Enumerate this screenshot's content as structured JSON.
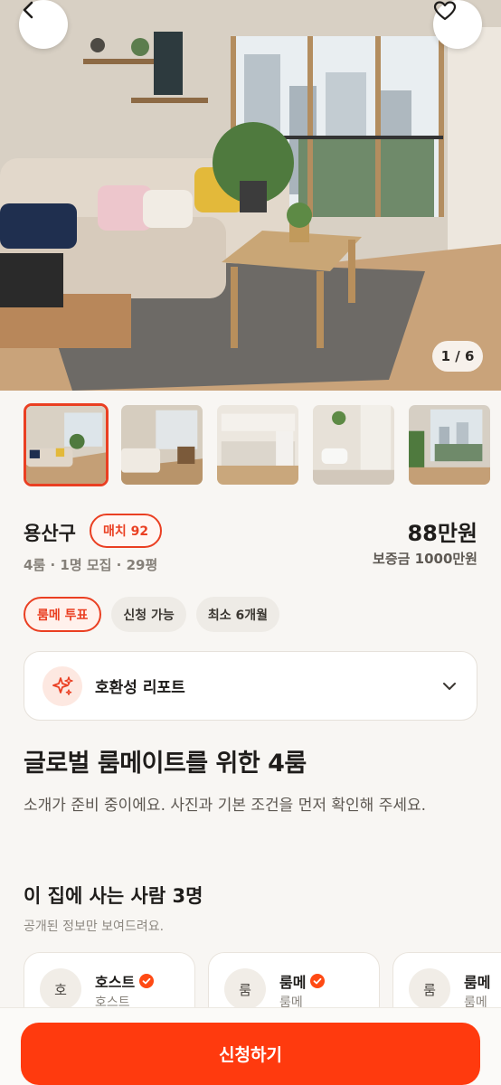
{
  "hero": {
    "counter": "1 / 6"
  },
  "thumbnails": [
    {
      "name": "living-room"
    },
    {
      "name": "bedroom"
    },
    {
      "name": "kitchen"
    },
    {
      "name": "bathroom"
    },
    {
      "name": "balcony"
    }
  ],
  "listing": {
    "district": "용산구",
    "match_badge": "매치 92",
    "meta": "4룸 · 1명 모집 · 29평",
    "price": "88만원",
    "deposit": "보증금 1000만원",
    "tags": [
      {
        "label": "룸메 투표",
        "primary": true
      },
      {
        "label": "신청 가능",
        "primary": false
      },
      {
        "label": "최소 6개월",
        "primary": false
      }
    ],
    "report_label": "호환성 리포트",
    "title": "글로벌 룸메이트를 위한 4룸",
    "description": "소개가 준비 중이에요. 사진과 기본 조건을 먼저 확인해 주세요."
  },
  "residents": {
    "title": "이 집에 사는 사람 3명",
    "subtitle": "공개된 정보만 보여드려요.",
    "people": [
      {
        "avatar": "호",
        "name": "호스트",
        "role": "호스트"
      },
      {
        "avatar": "룸",
        "name": "룸메",
        "role": "룸메"
      },
      {
        "avatar": "룸",
        "name": "룸메",
        "role": "룸메"
      }
    ]
  },
  "cta": {
    "apply_label": "신청하기"
  },
  "colors": {
    "accent": "#ea3f22",
    "cta": "#ff3a0e",
    "verified": "#ff4a14"
  },
  "icons": {
    "back": "chevron-left-icon",
    "favorite": "heart-icon",
    "report": "sparkles-icon",
    "expand": "chevron-down-icon",
    "verified": "verified-check-icon"
  }
}
